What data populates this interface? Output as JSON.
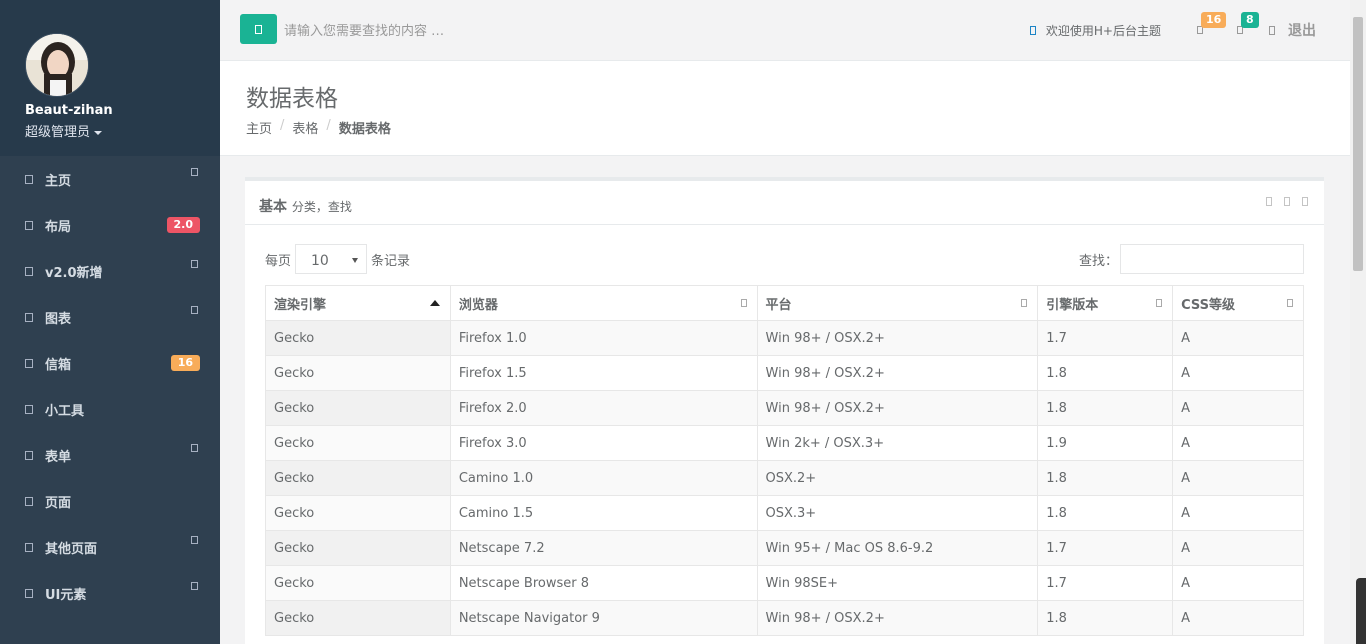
{
  "sidebar": {
    "profile": {
      "name": "Beaut-zihan",
      "role": "超级管理员"
    },
    "items": [
      {
        "label": "主页",
        "has_arrow": true
      },
      {
        "label": "布局",
        "badge": "2.0",
        "badge_color": "#ed5565"
      },
      {
        "label": "v2.0新增",
        "has_arrow": true
      },
      {
        "label": "图表",
        "has_arrow": true
      },
      {
        "label": "信箱",
        "badge": "16",
        "badge_color": "#f8ac59"
      },
      {
        "label": "小工具"
      },
      {
        "label": "表单",
        "has_arrow": true
      },
      {
        "label": "页面"
      },
      {
        "label": "其他页面",
        "has_arrow": true
      },
      {
        "label": "UI元素",
        "has_arrow": true
      }
    ]
  },
  "topbar": {
    "search_placeholder": "请输入您需要查找的内容 …",
    "welcome": "欢迎使用H+后台主题",
    "messages_count": "16",
    "alerts_count": "8",
    "logout": "退出"
  },
  "heading": {
    "title": "数据表格",
    "breadcrumb": [
      "主页",
      "表格",
      "数据表格"
    ]
  },
  "panel": {
    "title": "基本",
    "subtitle": "分类，查找",
    "length_prefix": "每页",
    "length_value": "10",
    "length_suffix": "条记录",
    "search_label": "查找："
  },
  "table": {
    "columns": [
      "渲染引擎",
      "浏览器",
      "平台",
      "引擎版本",
      "CSS等级"
    ],
    "rows": [
      [
        "Gecko",
        "Firefox 1.0",
        "Win 98+ / OSX.2+",
        "1.7",
        "A"
      ],
      [
        "Gecko",
        "Firefox 1.5",
        "Win 98+ / OSX.2+",
        "1.8",
        "A"
      ],
      [
        "Gecko",
        "Firefox 2.0",
        "Win 98+ / OSX.2+",
        "1.8",
        "A"
      ],
      [
        "Gecko",
        "Firefox 3.0",
        "Win 2k+ / OSX.3+",
        "1.9",
        "A"
      ],
      [
        "Gecko",
        "Camino 1.0",
        "OSX.2+",
        "1.8",
        "A"
      ],
      [
        "Gecko",
        "Camino 1.5",
        "OSX.3+",
        "1.8",
        "A"
      ],
      [
        "Gecko",
        "Netscape 7.2",
        "Win 95+ / Mac OS 8.6-9.2",
        "1.7",
        "A"
      ],
      [
        "Gecko",
        "Netscape Browser 8",
        "Win 98SE+",
        "1.7",
        "A"
      ],
      [
        "Gecko",
        "Netscape Navigator 9",
        "Win 98+ / OSX.2+",
        "1.8",
        "A"
      ]
    ]
  },
  "colors": {
    "sidebar_bg": "#2f4050",
    "accent_green": "#1ab394",
    "badge_red": "#ed5565",
    "badge_orange": "#f8ac59"
  }
}
